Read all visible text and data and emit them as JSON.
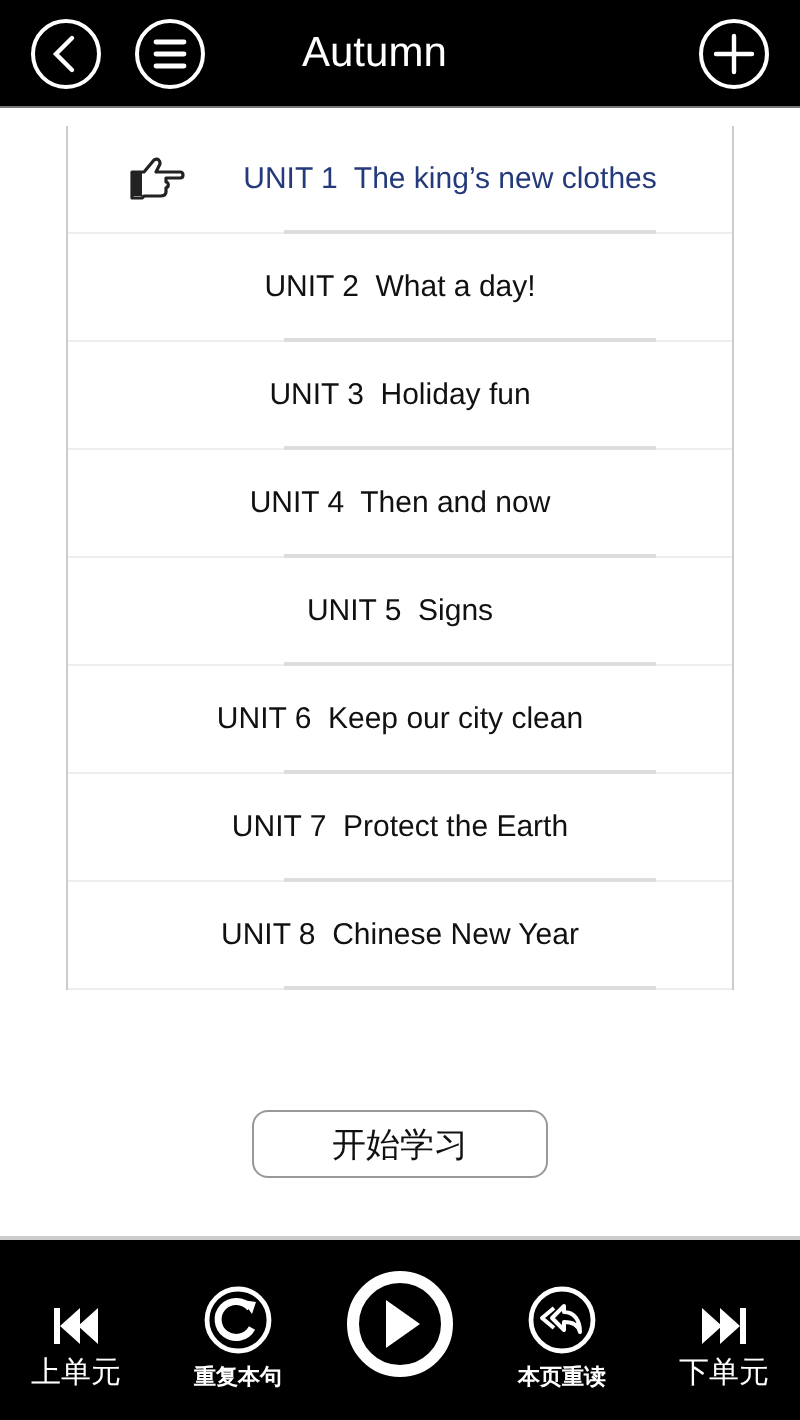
{
  "header": {
    "title": "Autumn"
  },
  "units": [
    {
      "label": "UNIT 1  The king’s new clothes",
      "selected": true
    },
    {
      "label": "UNIT 2  What a day!",
      "selected": false
    },
    {
      "label": "UNIT 3  Holiday fun",
      "selected": false
    },
    {
      "label": "UNIT 4  Then and now",
      "selected": false
    },
    {
      "label": "UNIT 5  Signs",
      "selected": false
    },
    {
      "label": "UNIT 6  Keep our city clean",
      "selected": false
    },
    {
      "label": "UNIT 7  Protect the Earth",
      "selected": false
    },
    {
      "label": "UNIT 8  Chinese New Year",
      "selected": false
    }
  ],
  "start_button": "开始学习",
  "controls": [
    {
      "kind": "prev",
      "label": "上单元"
    },
    {
      "kind": "repeat",
      "label": "重复本句"
    },
    {
      "kind": "play"
    },
    {
      "kind": "reread",
      "label": "本页重读"
    },
    {
      "kind": "next",
      "label": "下单元"
    }
  ]
}
